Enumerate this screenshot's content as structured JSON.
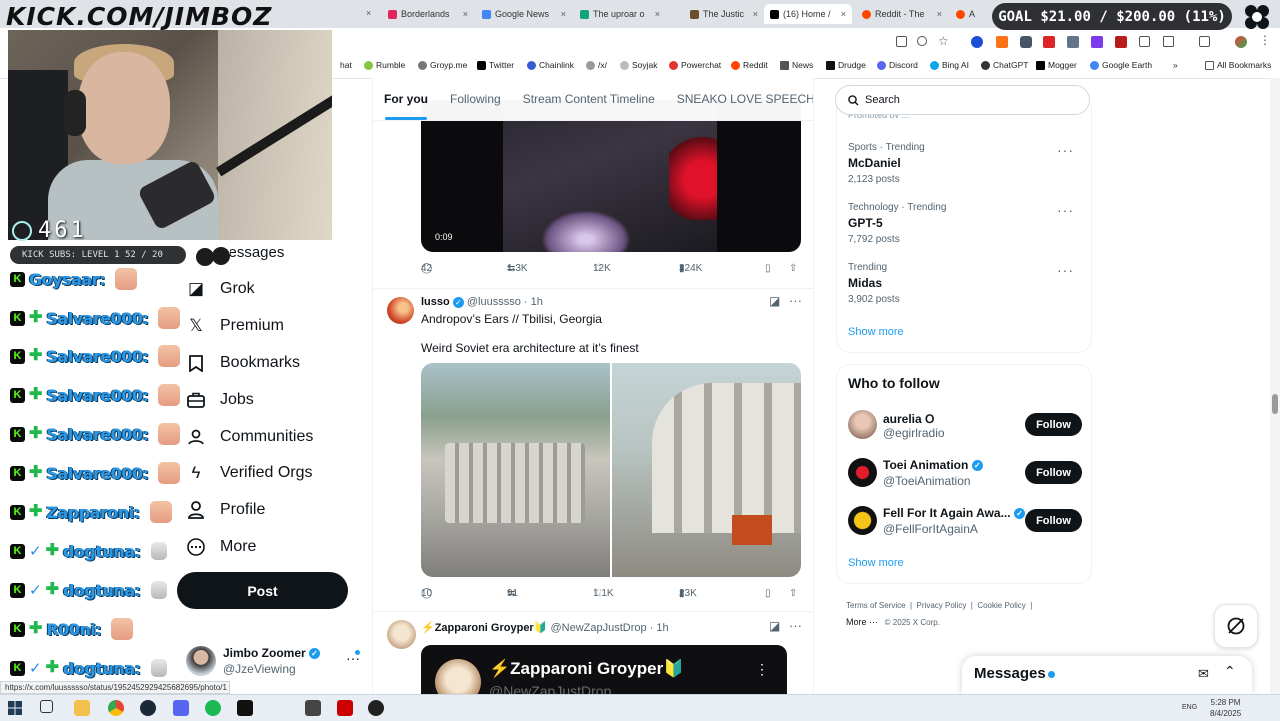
{
  "overlay": {
    "logo": "KICK.COM/JIMBOZ",
    "viewers": "461",
    "subs": "KICK SUBS: LEVEL 1 52 / 20",
    "goal": "GOAL $21.00 / $200.00 (11%)",
    "goal_progress": 0.11
  },
  "tabs": [
    {
      "label": "Borderlands",
      "color": "#e0245e"
    },
    {
      "label": "Google News",
      "color": "#4285f4"
    },
    {
      "label": "The uproar o",
      "color": "#10a37f"
    },
    {
      "label": "The Justic",
      "color": "#6b4f2a"
    },
    {
      "label": "(16) Home /",
      "color": "#000000"
    },
    {
      "label": "Reddit - The",
      "color": "#ff4500"
    },
    {
      "label": "A",
      "color": "#ff4500"
    }
  ],
  "bookmarks": [
    "hat",
    "Rumble",
    "Groyp.me",
    "Twitter",
    "Chainlink",
    "/x/",
    "Soyjak",
    "Powerchat",
    "Reddit",
    "News",
    "Drudge",
    "Discord",
    "Bing AI",
    "ChatGPT",
    "Mogger",
    "Google Earth"
  ],
  "bookmarks_all": "All Bookmarks",
  "chat": [
    {
      "name": "Goysaar:",
      "badges": "k",
      "emote": "face"
    },
    {
      "name": "Salvare000:",
      "badges": "k+",
      "emote": "face"
    },
    {
      "name": "Salvare000:",
      "badges": "k+",
      "emote": "face"
    },
    {
      "name": "Salvare000:",
      "badges": "k+",
      "emote": "face"
    },
    {
      "name": "Salvare000:",
      "badges": "k+",
      "emote": "face"
    },
    {
      "name": "Salvare000:",
      "badges": "k+",
      "emote": "face"
    },
    {
      "name": "Zapparoni:",
      "badges": "k+",
      "emote": "face"
    },
    {
      "name": "dogtuna:",
      "badges": "kv+",
      "emote": "ghost"
    },
    {
      "name": "dogtuna:",
      "badges": "kv+",
      "emote": "ghost"
    },
    {
      "name": "R00ni:",
      "badges": "k+",
      "emote": "face"
    },
    {
      "name": "dogtuna:",
      "badges": "kv+",
      "emote": "ghost"
    }
  ],
  "nav": {
    "messages": "Messages",
    "items": [
      "Grok",
      "Premium",
      "Bookmarks",
      "Jobs",
      "Communities",
      "Verified Orgs",
      "Profile",
      "More"
    ],
    "post": "Post",
    "profile_name": "Jimbo Zoomer",
    "profile_handle": "@JzeViewing"
  },
  "timeline": {
    "tabs": [
      "For you",
      "Following",
      "Stream Content Timeline",
      "SNEAKO LOVE SPEECH"
    ],
    "video_time": "0:09",
    "tweet1_actions": {
      "replies": "42",
      "reposts": "1.3K",
      "likes": "12K",
      "views": "324K"
    },
    "tweet2": {
      "name": "lusso",
      "handle": "@luusssso · 1h",
      "line1": "Andropov’s Ears // Tbilisi, Georgia",
      "line2": "Weird Soviet era architecture at it’s finest",
      "replies": "10",
      "reposts": "91",
      "likes": "1.1K",
      "views": "23K"
    },
    "tweet3": {
      "name": "⚡Zapparoni Groyper🔰",
      "handle": "@NewZapJustDrop · 1h",
      "card_title": "⚡Zapparoni Groyper🔰",
      "card_handle": "@NewZapJustDrop"
    }
  },
  "right": {
    "search_placeholder": "Search",
    "promoted_cut": "Promoted by ...",
    "trends": [
      {
        "cat": "Sports · Trending",
        "name": "McDaniel",
        "count": "2,123 posts"
      },
      {
        "cat": "Technology · Trending",
        "name": "GPT-5",
        "count": "7,792 posts"
      },
      {
        "cat": "Trending",
        "name": "Midas",
        "count": "3,902 posts"
      }
    ],
    "show_more": "Show more",
    "wtf_title": "Who to follow",
    "follow": [
      {
        "name": "aurelia 𐊫",
        "handle": "@egirlradio",
        "verified": false
      },
      {
        "name": "Toei Animation",
        "handle": "@ToeiAnimation",
        "verified": true
      },
      {
        "name": "Fell For It Again Awa...",
        "handle": "@FellForItAgainA",
        "verified": true
      }
    ],
    "follow_label": "Follow",
    "show_more2": "Show more",
    "footer": [
      "Terms of Service",
      "Privacy Policy",
      "Cookie Policy",
      "More ···",
      "© 2025 X Corp."
    ],
    "messages": "Messages"
  },
  "status_url": "https://x.com/luussssso/status/1952452929425682695/photo/1",
  "taskbar": {
    "lang": "ENG",
    "time": "5:28 PM",
    "date": "8/4/2025"
  },
  "colors": {
    "x_blue": "#1d9bf0",
    "kick_green": "#53fc18"
  }
}
